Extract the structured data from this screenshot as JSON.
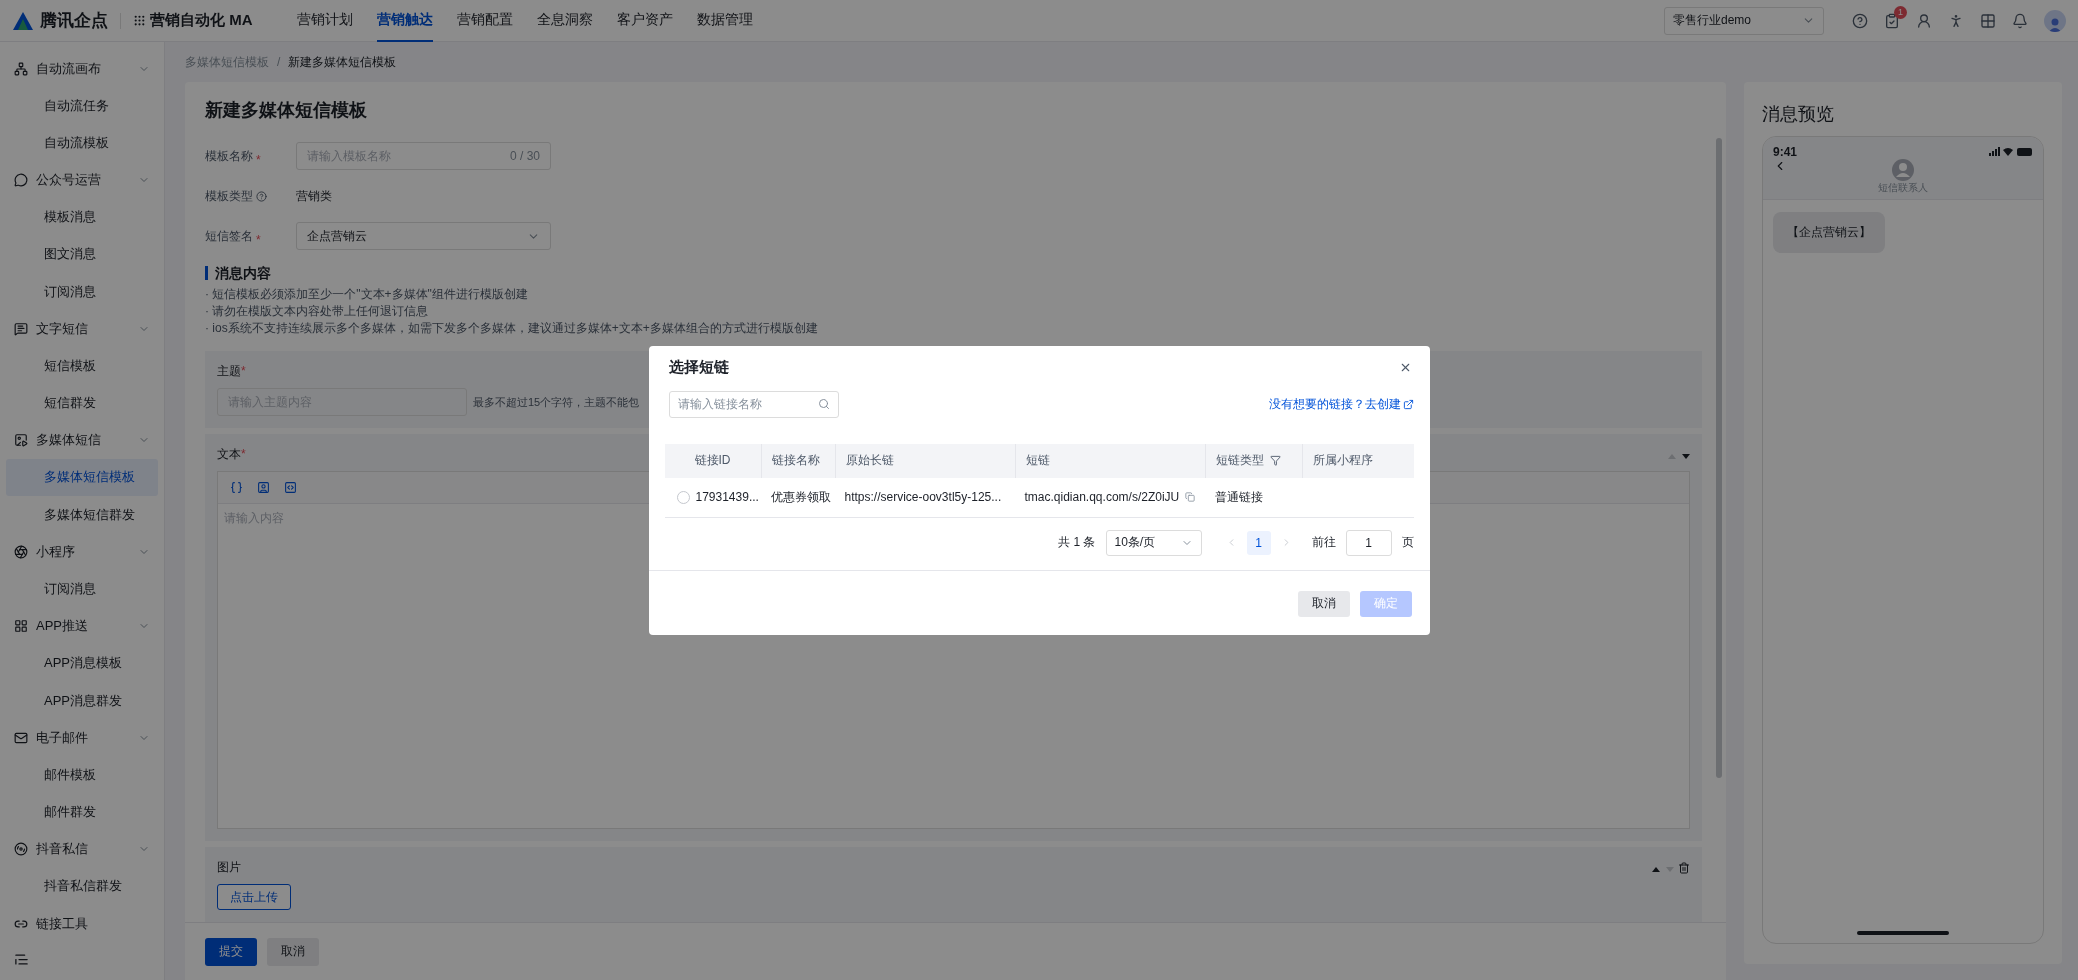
{
  "topbar": {
    "brand": "腾讯企点",
    "product": "营销自动化 MA",
    "nav": [
      {
        "label": "营销计划",
        "selected": false
      },
      {
        "label": "营销触达",
        "selected": true
      },
      {
        "label": "营销配置",
        "selected": false
      },
      {
        "label": "全息洞察",
        "selected": false
      },
      {
        "label": "客户资产",
        "selected": false
      },
      {
        "label": "数据管理",
        "selected": false
      }
    ],
    "tenant": "零售行业demo",
    "task_badge": "1"
  },
  "sidebar": {
    "groups": [
      {
        "label": "自动流画布",
        "expanded": true,
        "children": [
          {
            "label": "自动流任务",
            "selected": false
          },
          {
            "label": "自动流模板",
            "selected": false
          }
        ]
      },
      {
        "label": "公众号运营",
        "expanded": true,
        "children": [
          {
            "label": "模板消息",
            "selected": false
          },
          {
            "label": "图文消息",
            "selected": false
          },
          {
            "label": "订阅消息",
            "selected": false
          }
        ]
      },
      {
        "label": "文字短信",
        "expanded": true,
        "children": [
          {
            "label": "短信模板",
            "selected": false
          },
          {
            "label": "短信群发",
            "selected": false
          }
        ]
      },
      {
        "label": "多媒体短信",
        "expanded": true,
        "children": [
          {
            "label": "多媒体短信模板",
            "selected": true
          },
          {
            "label": "多媒体短信群发",
            "selected": false
          }
        ]
      },
      {
        "label": "小程序",
        "expanded": true,
        "children": [
          {
            "label": "订阅消息",
            "selected": false
          }
        ]
      },
      {
        "label": "APP推送",
        "expanded": true,
        "children": [
          {
            "label": "APP消息模板",
            "selected": false
          },
          {
            "label": "APP消息群发",
            "selected": false
          }
        ]
      },
      {
        "label": "电子邮件",
        "expanded": true,
        "children": [
          {
            "label": "邮件模板",
            "selected": false
          },
          {
            "label": "邮件群发",
            "selected": false
          }
        ]
      },
      {
        "label": "抖音私信",
        "expanded": true,
        "children": [
          {
            "label": "抖音私信群发",
            "selected": false
          }
        ]
      },
      {
        "label": "链接工具",
        "expanded": false
      }
    ]
  },
  "breadcrumb": {
    "separator": "/",
    "items": [
      "多媒体短信模板",
      "新建多媒体短信模板"
    ]
  },
  "form": {
    "title": "新建多媒体短信模板",
    "required_mark": "*",
    "fields": [
      {
        "kind": "input",
        "label": "模板名称",
        "required": true,
        "placeholder": "请输入模板名称",
        "counter": "0 / 30"
      },
      {
        "kind": "static",
        "label": "模板类型",
        "required": false,
        "value": "营销类"
      },
      {
        "kind": "select",
        "label": "短信签名",
        "required": true,
        "value": "企点营销云"
      }
    ],
    "section_title": "消息内容",
    "notes": [
      "· 短信模板必须添加至少一个\"文本+多媒体\"组件进行模版创建",
      "· 请勿在模版文本内容处带上任何退订信息",
      "· ios系统不支持连续展示多个多媒体，如需下发多个多媒体，建议通过多媒体+文本+多媒体组合的方式进行模版创建"
    ],
    "blocks": [
      {
        "kind": "subject",
        "label": "主题",
        "required": true,
        "placeholder": "请输入主题内容",
        "hint": "最多不超过15个字符，主题不能包"
      },
      {
        "kind": "text",
        "label": "文本",
        "required": true,
        "placeholder": "请输入内容",
        "up_disabled": true,
        "down_disabled": false
      },
      {
        "kind": "image",
        "label": "图片",
        "required": false,
        "button": "点击上传",
        "up_disabled": false,
        "down_disabled": true
      }
    ],
    "actions": [
      "提交",
      "取消"
    ]
  },
  "preview": {
    "title": "消息预览",
    "time": "9:41",
    "contact": "短信联系人",
    "message": "【企点营销云】"
  },
  "dialog": {
    "title": "选择短链",
    "search_placeholder": "请输入链接名称",
    "create_link": "没有想要的链接？去创建",
    "columns": [
      "链接ID",
      "链接名称",
      "原始长链",
      "短链",
      "短链类型",
      "所属小程序"
    ],
    "rows": [
      {
        "selected": false,
        "id": "17931439...",
        "name": "优惠券领取",
        "long_link": "https://service-oov3tl5y-125...",
        "short_link": "tmac.qidian.qq.com/s/2Z0iJU",
        "type": "普通链接"
      }
    ],
    "total": "共 1 条",
    "page_size": "10条/页",
    "pages": [
      {
        "label": "1",
        "selected": true
      }
    ],
    "goto_label": "前往",
    "goto_value": "1",
    "goto_unit": "页",
    "buttons": [
      {
        "label": "取消",
        "kind": "secondary",
        "disabled": false
      },
      {
        "label": "确定",
        "kind": "primary",
        "disabled": true
      }
    ]
  }
}
